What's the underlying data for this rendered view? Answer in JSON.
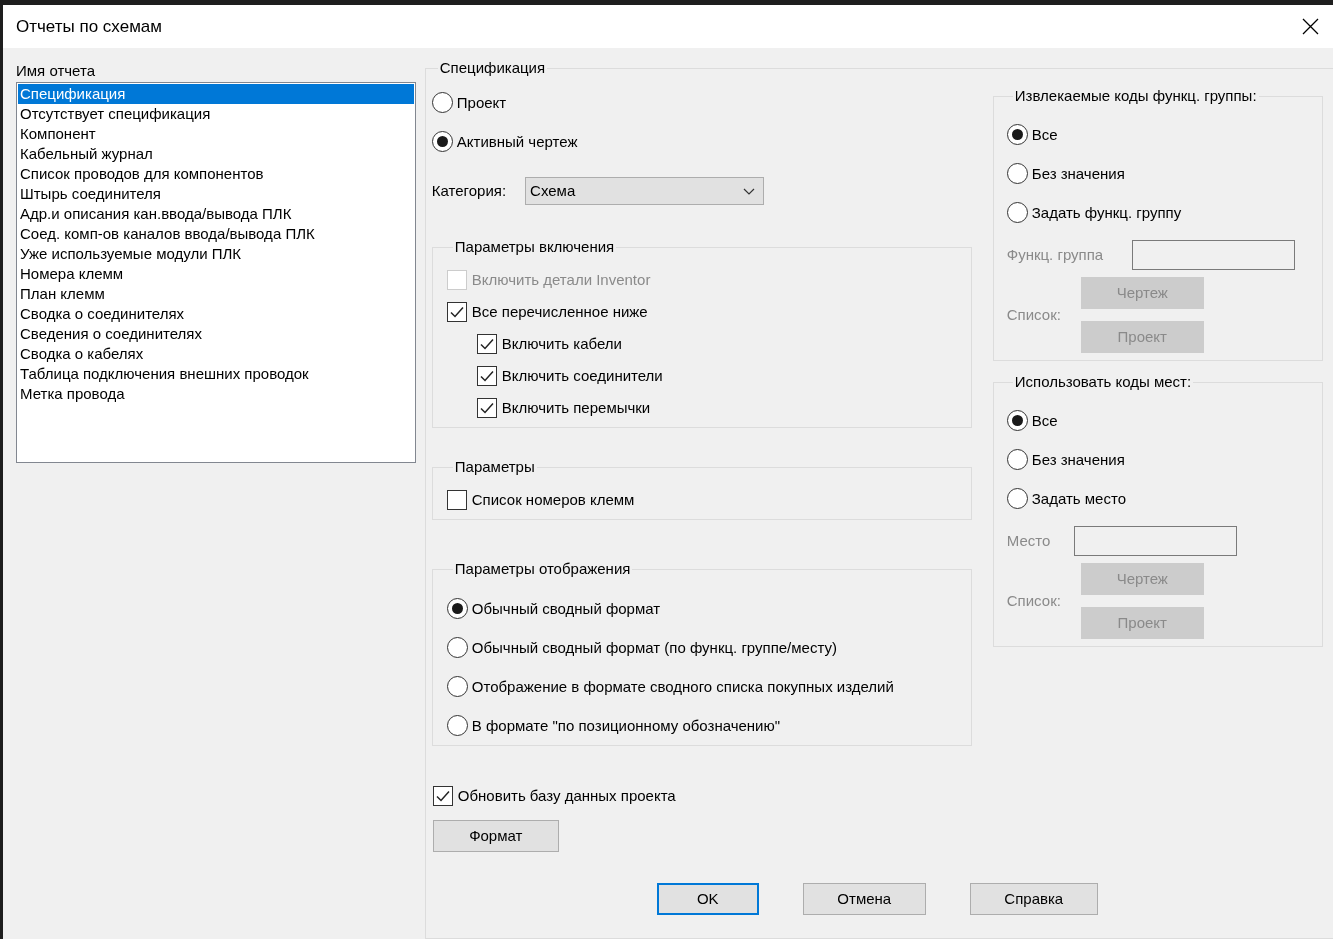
{
  "window": {
    "title": "Отчеты по схемам"
  },
  "report_list": {
    "label": "Имя отчета",
    "items": [
      {
        "label": "Спецификация",
        "selected": true
      },
      {
        "label": "Отсутствует спецификация",
        "selected": false
      },
      {
        "label": "Компонент",
        "selected": false
      },
      {
        "label": "Кабельный журнал",
        "selected": false
      },
      {
        "label": "Список проводов для компонентов",
        "selected": false
      },
      {
        "label": "Штырь соединителя",
        "selected": false
      },
      {
        "label": "Адр.и описания кан.ввода/вывода ПЛК",
        "selected": false
      },
      {
        "label": "Соед. комп-ов каналов ввода/вывода ПЛК",
        "selected": false
      },
      {
        "label": "Уже используемые модули ПЛК",
        "selected": false
      },
      {
        "label": "Номера клемм",
        "selected": false
      },
      {
        "label": "План клемм",
        "selected": false
      },
      {
        "label": "Сводка о соединителях",
        "selected": false
      },
      {
        "label": "Сведения о соединителях",
        "selected": false
      },
      {
        "label": "Сводка о кабелях",
        "selected": false
      },
      {
        "label": "Таблица подключения внешних проводок",
        "selected": false
      },
      {
        "label": "Метка провода",
        "selected": false
      }
    ]
  },
  "specification": {
    "title": "Спецификация",
    "scope": [
      {
        "label": "Проект",
        "selected": false
      },
      {
        "label": "Активный чертеж",
        "selected": true
      }
    ],
    "category": {
      "label": "Категория:",
      "value": "Схема"
    },
    "include": {
      "title": "Параметры включения",
      "items": [
        {
          "label": "Включить детали Inventor",
          "checked": false,
          "disabled": true
        },
        {
          "label": "Все перечисленное ниже",
          "checked": true,
          "disabled": false,
          "children": [
            {
              "label": "Включить кабели",
              "checked": true,
              "disabled": false
            },
            {
              "label": "Включить соединители",
              "checked": true,
              "disabled": false
            },
            {
              "label": "Включить перемычки",
              "checked": true,
              "disabled": false
            }
          ]
        }
      ]
    },
    "parameters": {
      "title": "Параметры",
      "items": [
        {
          "label": "Список номеров клемм",
          "checked": false,
          "disabled": false
        }
      ]
    },
    "display": {
      "title": "Параметры отображения",
      "options": [
        {
          "label": "Обычный сводный формат",
          "selected": true
        },
        {
          "label": "Обычный сводный формат (по функц. группе/месту)",
          "selected": false
        },
        {
          "label": "Отображение в формате сводного списка покупных изделий",
          "selected": false
        },
        {
          "label": "В формате \"по позиционному обозначению\"",
          "selected": false
        }
      ]
    },
    "update_db": {
      "label": "Обновить базу данных проекта",
      "checked": true,
      "disabled": false
    },
    "format_button": "Формат"
  },
  "function_codes": {
    "title": "Извлекаемые коды функц. группы:",
    "options": [
      {
        "label": "Все",
        "selected": true
      },
      {
        "label": "Без значения",
        "selected": false
      },
      {
        "label": "Задать функц. группу",
        "selected": false
      }
    ],
    "field": {
      "label": "Функц. группа",
      "disabled": true
    },
    "list_label": "Список:",
    "buttons": [
      {
        "label": "Чертеж",
        "disabled": true
      },
      {
        "label": "Проект",
        "disabled": true
      }
    ]
  },
  "location_codes": {
    "title": "Использовать коды мест:",
    "options": [
      {
        "label": "Все",
        "selected": true
      },
      {
        "label": "Без значения",
        "selected": false
      },
      {
        "label": "Задать место",
        "selected": false
      }
    ],
    "field": {
      "label": "Место",
      "disabled": true
    },
    "list_label": "Список:",
    "buttons": [
      {
        "label": "Чертеж",
        "disabled": true
      },
      {
        "label": "Проект",
        "disabled": true
      }
    ]
  },
  "buttons": [
    {
      "label": "OK",
      "default": true
    },
    {
      "label": "Отмена",
      "default": false
    },
    {
      "label": "Справка",
      "default": false
    }
  ]
}
